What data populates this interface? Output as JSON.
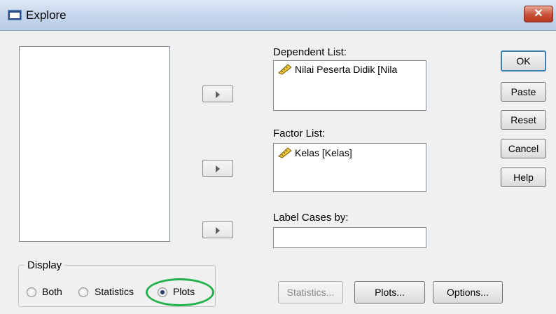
{
  "window": {
    "title": "Explore",
    "close_label": "✕"
  },
  "dependent": {
    "label": "Dependent List:",
    "items": [
      "Nilai Peserta Didik [Nila"
    ]
  },
  "factor": {
    "label": "Factor List:",
    "items": [
      "Kelas [Kelas]"
    ]
  },
  "label_cases": {
    "label": "Label Cases by:",
    "value": ""
  },
  "side_buttons": {
    "ok": "OK",
    "paste": "Paste",
    "reset": "Reset",
    "cancel": "Cancel",
    "help": "Help"
  },
  "display": {
    "legend": "Display",
    "options": [
      "Both",
      "Statistics",
      "Plots"
    ],
    "selected": "Plots"
  },
  "bottom_buttons": {
    "statistics": "Statistics...",
    "plots": "Plots...",
    "options": "Options..."
  },
  "colors": {
    "highlight": "#22b14c",
    "default_button_border": "#3c7fb1"
  }
}
